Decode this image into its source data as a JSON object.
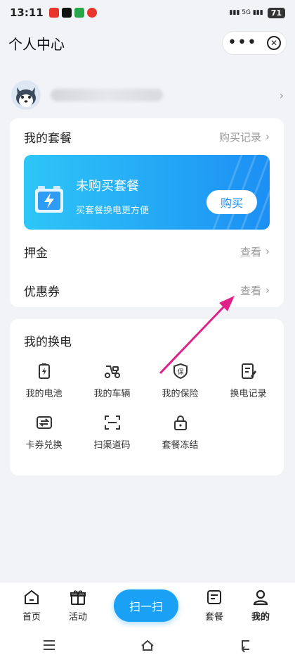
{
  "status": {
    "time": "13:11",
    "battery": "71"
  },
  "header": {
    "title": "个人中心"
  },
  "package": {
    "title": "我的套餐",
    "history_label": "购买记录",
    "banner_title": "未购买套餐",
    "banner_subtitle": "买套餐换电更方便",
    "buy_label": "购买"
  },
  "deposit": {
    "label": "押金",
    "action": "查看"
  },
  "coupon": {
    "label": "优惠券",
    "action": "查看"
  },
  "swap": {
    "title": "我的换电",
    "items": [
      {
        "label": "我的电池",
        "icon": "battery-icon"
      },
      {
        "label": "我的车辆",
        "icon": "scooter-icon"
      },
      {
        "label": "我的保险",
        "icon": "insurance-icon"
      },
      {
        "label": "换电记录",
        "icon": "record-icon"
      },
      {
        "label": "卡券兑换",
        "icon": "exchange-icon"
      },
      {
        "label": "扫渠道码",
        "icon": "scan-icon"
      },
      {
        "label": "套餐冻结",
        "icon": "lock-icon"
      }
    ]
  },
  "tabbar": {
    "home": "首页",
    "activity": "活动",
    "scan": "扫一扫",
    "package": "套餐",
    "mine": "我的"
  },
  "colors": {
    "accent": "#1aa0f5",
    "banner_start": "#2ec6f7",
    "banner_end": "#1c8ff4",
    "arrow": "#e0218a"
  }
}
